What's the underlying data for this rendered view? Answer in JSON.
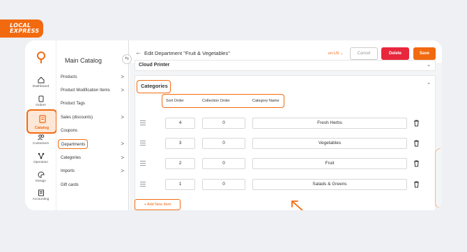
{
  "brand": {
    "line1": "LOCAL",
    "line2": "EXPRESS",
    "accent": "#f26a10"
  },
  "rail": [
    {
      "label": "Dashboard",
      "icon": "home-icon"
    },
    {
      "label": "Orders",
      "icon": "clipboard-icon"
    },
    {
      "label": "Catalog",
      "icon": "catalog-icon",
      "active": true
    },
    {
      "label": "Customers",
      "icon": "people-icon"
    },
    {
      "label": "Operation",
      "icon": "network-icon"
    },
    {
      "label": "Design",
      "icon": "palette-icon"
    },
    {
      "label": "Accounting",
      "icon": "ledger-icon"
    }
  ],
  "subnav": {
    "title": "Main Catalog",
    "items": [
      {
        "label": "Products",
        "chevron": ">"
      },
      {
        "label": "Product Modification Items",
        "chevron": ">"
      },
      {
        "label": "Product Tags",
        "chevron": ""
      },
      {
        "label": "Sales (discounts)",
        "chevron": ">"
      },
      {
        "label": "Coupons",
        "chevron": ""
      },
      {
        "label": "Departments",
        "chevron": ">"
      },
      {
        "label": "Categories",
        "chevron": ">"
      },
      {
        "label": "Imports",
        "chevron": ">"
      },
      {
        "label": "Gift cards",
        "chevron": ""
      }
    ]
  },
  "topbar": {
    "back": "←",
    "title": "Edit Department \"Fruit & Vegetables\"",
    "lang": "en-US",
    "cancel": "Cancel",
    "delete": "Delete",
    "save": "Save"
  },
  "printer": {
    "title": "Cloud Printer"
  },
  "categories": {
    "title": "Categories",
    "columns": {
      "sort": "Sort Order",
      "collection": "Collection Order",
      "name": "Category Name"
    },
    "rows": [
      {
        "sort": "4",
        "collection": "0",
        "name": "Fresh Herbs"
      },
      {
        "sort": "3",
        "collection": "0",
        "name": "Vegetables"
      },
      {
        "sort": "2",
        "collection": "0",
        "name": "Fruit"
      },
      {
        "sort": "1",
        "collection": "0",
        "name": "Salads & Greens"
      }
    ],
    "add_label": "+ Add New Item"
  }
}
